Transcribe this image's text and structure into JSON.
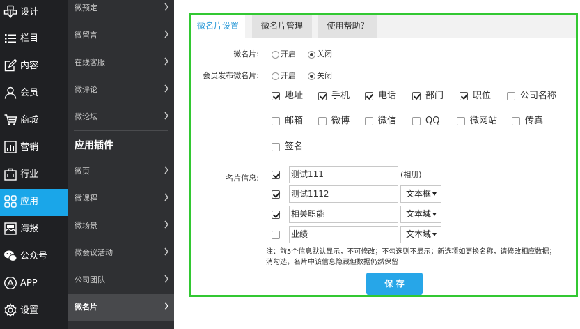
{
  "main_nav": [
    {
      "label": "设计",
      "icon": "design-icon"
    },
    {
      "label": "栏目",
      "icon": "list-icon"
    },
    {
      "label": "内容",
      "icon": "edit-icon"
    },
    {
      "label": "会员",
      "icon": "user-icon"
    },
    {
      "label": "商城",
      "icon": "cart-icon"
    },
    {
      "label": "营销",
      "icon": "chart-icon"
    },
    {
      "label": "行业",
      "icon": "briefcase-icon"
    },
    {
      "label": "应用",
      "icon": "apps-icon",
      "active": true
    },
    {
      "label": "海报",
      "icon": "poster-icon"
    },
    {
      "label": "公众号",
      "icon": "wechat-icon"
    },
    {
      "label": "APP",
      "icon": "appstore-icon"
    },
    {
      "label": "设置",
      "icon": "gear-icon"
    }
  ],
  "sub_nav": {
    "top_items": [
      "微预定",
      "微留言",
      "在线客服",
      "微评论",
      "微论坛"
    ],
    "section_heading": "应用插件",
    "plugin_items": [
      "微页",
      "微课程",
      "微场景",
      "微会议活动",
      "公司团队",
      "微名片"
    ],
    "active_item": "微名片"
  },
  "tabs": [
    "微名片设置",
    "微名片管理",
    "使用帮助？"
  ],
  "form": {
    "card_label": "微名片:",
    "card_options": {
      "on": "开启",
      "off": "关闭",
      "selected": "关闭"
    },
    "member_label": "会员发布微名片:",
    "member_options": {
      "on": "开启",
      "off": "关闭",
      "selected": "关闭"
    },
    "fields": [
      {
        "label": "地址",
        "checked": true
      },
      {
        "label": "手机",
        "checked": true
      },
      {
        "label": "电话",
        "checked": true
      },
      {
        "label": "部门",
        "checked": true
      },
      {
        "label": "职位",
        "checked": true
      },
      {
        "label": "公司名称",
        "checked": false
      },
      {
        "label": "邮箱",
        "checked": false
      },
      {
        "label": "微博",
        "checked": false
      },
      {
        "label": "微信",
        "checked": false
      },
      {
        "label": "QQ",
        "checked": false
      },
      {
        "label": "微网站",
        "checked": false
      },
      {
        "label": "传真",
        "checked": false
      },
      {
        "label": "签名",
        "checked": false
      }
    ],
    "card_info_label": "名片信息:",
    "card_info_rows": [
      {
        "value": "测试111",
        "checked": true,
        "extra": "(相册)"
      },
      {
        "value": "测试1112",
        "checked": true,
        "select": "文本框"
      },
      {
        "value": "相关职能",
        "checked": true,
        "select": "文本域"
      },
      {
        "value": "业绩",
        "checked": false,
        "select": "文本域"
      }
    ],
    "note_line1": "注：前5个信息默认显示，不可修改；不勾选则不显示；新选项如更换名称，请修改相应数据；",
    "note_line2": "消勾选，名片中该信息隐藏但数据仍然保留",
    "save_label": "保 存"
  },
  "colors": {
    "accent": "#1aa6e9",
    "highlight_border": "#32c832",
    "nav_bg": "#1f2023",
    "subnav_bg": "#2f3033"
  }
}
